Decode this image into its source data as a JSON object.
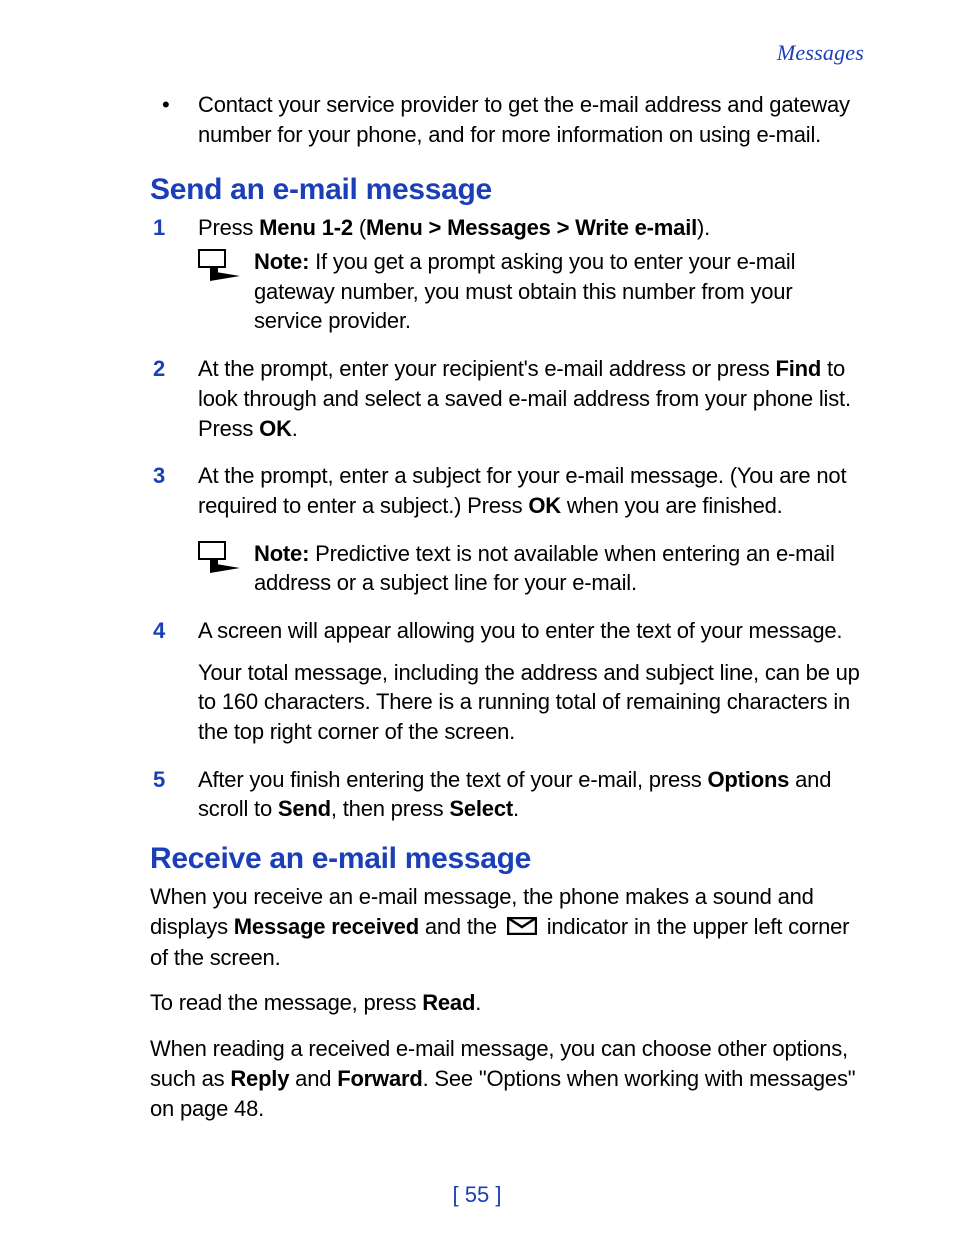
{
  "header": "Messages",
  "intro_bullet": "Contact your service provider to get the e-mail address and gateway number for your phone, and for more information on using e-mail.",
  "section1": {
    "heading": "Send an e-mail message",
    "step1": {
      "pre": "Press ",
      "bold": "Menu 1-2 ",
      "mid": "(",
      "path": "Menu > Messages > Write e-mail",
      "post": ").",
      "note_label": "Note:  ",
      "note_body": "If you get a prompt asking you to enter your e-mail gateway number, you must obtain this number from your service provider."
    },
    "step2": {
      "t1": "At the prompt, enter your recipient's e-mail address or press ",
      "b1": "Find",
      "t2": " to look through and select a saved e-mail address from your phone list. Press ",
      "b2": "OK",
      "t3": "."
    },
    "step3": {
      "t1": "At the prompt, enter a subject for your e-mail message. (You are not required to enter a subject.) Press ",
      "b1": "OK",
      "t2": " when you are finished.",
      "note_label": "Note: ",
      "note_body": "Predictive text is not available when entering an e-mail address or a subject line for your e-mail."
    },
    "step4": {
      "t1": "A screen will appear allowing you to enter the text of your message.",
      "t2": "Your total message, including the address and subject line, can be up to 160 characters. There is a running total of remaining characters in the top right corner of the screen."
    },
    "step5": {
      "t1": "After you finish entering the text of your e-mail, press ",
      "b1": "Options",
      "t2": " and scroll to ",
      "b2": "Send",
      "t3": ", then press ",
      "b3": "Select",
      "t4": "."
    }
  },
  "section2": {
    "heading": "Receive an e-mail message",
    "p1": {
      "t1": "When you receive an e-mail message, the phone makes a sound and displays ",
      "b1": "Message received",
      "t2": " and the ",
      "t3": " indicator in the upper left corner of the screen."
    },
    "p2": {
      "t1": "To read the message, press ",
      "b1": "Read",
      "t2": "."
    },
    "p3": {
      "t1": "When reading a received e-mail message, you can choose other options, such as ",
      "b1": "Reply",
      "t2": " and ",
      "b2": "Forward",
      "t3": ". See \"Options when working with messages\" on page 48."
    }
  },
  "footer": "[ 55 ]"
}
